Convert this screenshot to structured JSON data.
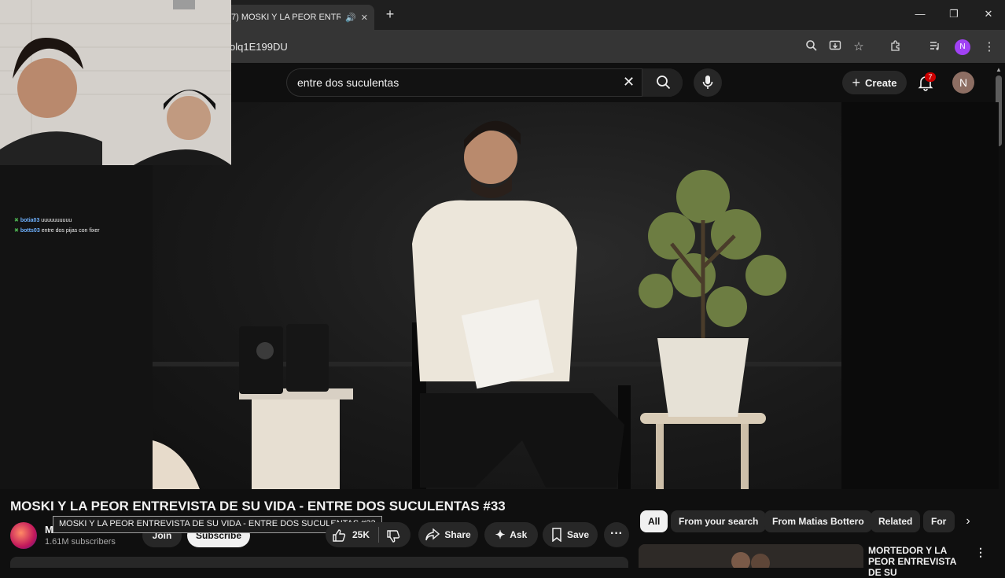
{
  "browser": {
    "tab_title": "7) MOSKI Y LA PEOR ENTR",
    "url_fragment": "olq1E199DU"
  },
  "header": {
    "search_value": "entre dos suculentas",
    "create_label": "Create",
    "notifications_count": "7",
    "avatar_initial": "N"
  },
  "chat": {
    "messages": [
      {
        "user": "botia03",
        "text": "uuuuuuuuuu"
      },
      {
        "user": "botts03",
        "text": "entre dos pijas con fixer"
      }
    ]
  },
  "video": {
    "title": "MOSKI Y LA PEOR ENTREVISTA DE SU VIDA - ENTRE DOS SUCULENTAS #33",
    "tooltip": "MOSKI Y LA PEOR ENTREVISTA DE SU VIDA - ENTRE DOS SUCULENTAS #33",
    "channel_initial": "M",
    "subscribers": "1.61M subscribers",
    "join_label": "Join",
    "subscribe_label": "Subscribe",
    "likes": "25K",
    "share_label": "Share",
    "ask_label": "Ask",
    "save_label": "Save"
  },
  "chips": [
    "All",
    "From your search",
    "From Matias Bottero",
    "Related",
    "For"
  ],
  "related": {
    "title": "MORTEDOR Y LA PEOR ENTREVISTA DE SU"
  },
  "colors": {
    "background": "#0f0f0f",
    "chrome_toolbar": "#353535",
    "pill": "#272727",
    "badge": "#cc0000"
  }
}
